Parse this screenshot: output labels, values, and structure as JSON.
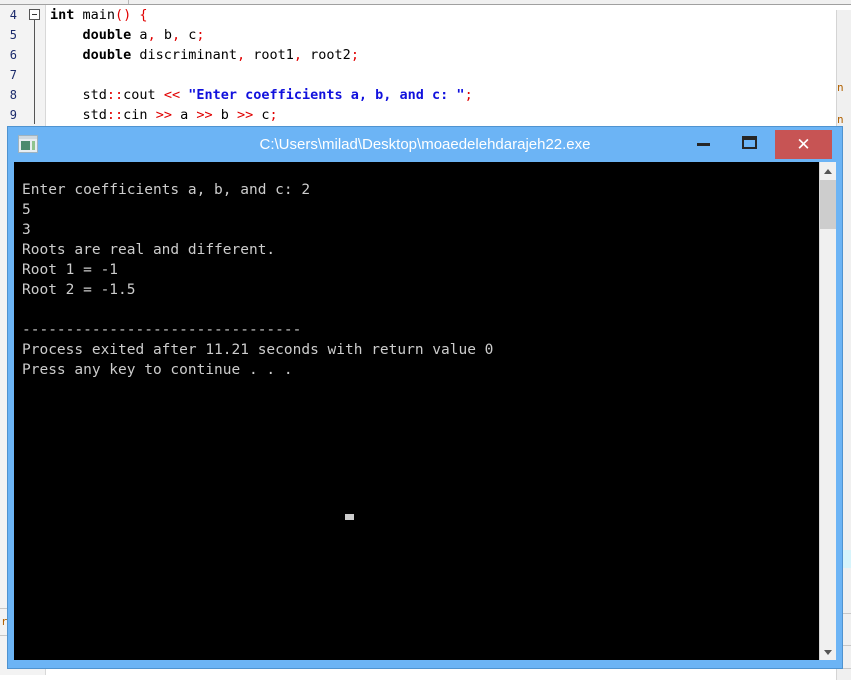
{
  "editor": {
    "gutter_line_numbers": [
      "4",
      "5",
      "6",
      "7",
      "8",
      "9"
    ],
    "lines": [
      {
        "num": "4",
        "text": "int main() {"
      },
      {
        "num": "5",
        "text": "    double a, b, c;"
      },
      {
        "num": "6",
        "text": "    double discriminant, root1, root2;"
      },
      {
        "num": "7",
        "text": ""
      },
      {
        "num": "8",
        "text": "    std::cout << \"Enter coefficients a, b, and c: \";"
      },
      {
        "num": "9",
        "text": "    std::cin >> a >> b >> c;"
      }
    ],
    "tokens": {
      "l4_kw": "int",
      "l4_name": " main",
      "l4_parens": "()",
      "l4_brace": " {",
      "l5_indent": "    ",
      "l5_kw": "double",
      "l5_a": " a",
      "l5_c1": ",",
      "l5_b": " b",
      "l5_c2": ",",
      "l5_c": " c",
      "l5_semi": ";",
      "l6_indent": "    ",
      "l6_kw": "double",
      "l6_d": " discriminant",
      "l6_c1": ",",
      "l6_r1": " root1",
      "l6_c2": ",",
      "l6_r2": " root2",
      "l6_semi": ";",
      "l8_indent": "    ",
      "l8_std": "std",
      "l8_scope": "::",
      "l8_cout": "cout ",
      "l8_shift": "<<",
      "l8_space": " ",
      "l8_string": "\"Enter coefficients a, b, and c: \"",
      "l8_semi": ";",
      "l9_indent": "    ",
      "l9_std": "std",
      "l9_scope": "::",
      "l9_cin": "cin ",
      "l9_in1": ">>",
      "l9_a": " a ",
      "l9_in2": ">>",
      "l9_b": " b ",
      "l9_in3": ">>",
      "l9_c": " c",
      "l9_semi": ";"
    },
    "colors": {
      "keyword": "#000000",
      "operator": "#e00000",
      "string": "#1111dd",
      "line_number": "#1b2a6b",
      "gutter_bg": "#f3f3f3"
    }
  },
  "background_panels": {
    "left_fragment": "r",
    "right_fragments": [
      "n",
      "n"
    ]
  },
  "console_window": {
    "title": "C:\\Users\\milad\\Desktop\\moaedelehdarajeh22.exe",
    "icon_name": "console-app-icon",
    "accent_color": "#6cb4f5",
    "close_color": "#c75454",
    "caption_buttons": {
      "minimize": "–",
      "maximize": "□",
      "close": "✕"
    },
    "output": "Enter coefficients a, b, and c: 2\n5\n3\nRoots are real and different.\nRoot 1 = -1\nRoot 2 = -1.5\n\n--------------------------------\nProcess exited after 11.21 seconds with return value 0\nPress any key to continue . . .",
    "output_lines": [
      "Enter coefficients a, b, and c: 2",
      "5",
      "3",
      "Roots are real and different.",
      "Root 1 = -1",
      "Root 2 = -1.5",
      "",
      "--------------------------------",
      "Process exited after 11.21 seconds with return value 0",
      "Press any key to continue . . ."
    ],
    "values": {
      "coefficient_a": "2",
      "coefficient_b": "5",
      "coefficient_c": "3",
      "root1": "-1",
      "root2": "-1.5",
      "elapsed_seconds": "11.21",
      "return_value": "0"
    },
    "scrollbar": {
      "up_arrow": "▲",
      "down_arrow": "▼"
    }
  }
}
